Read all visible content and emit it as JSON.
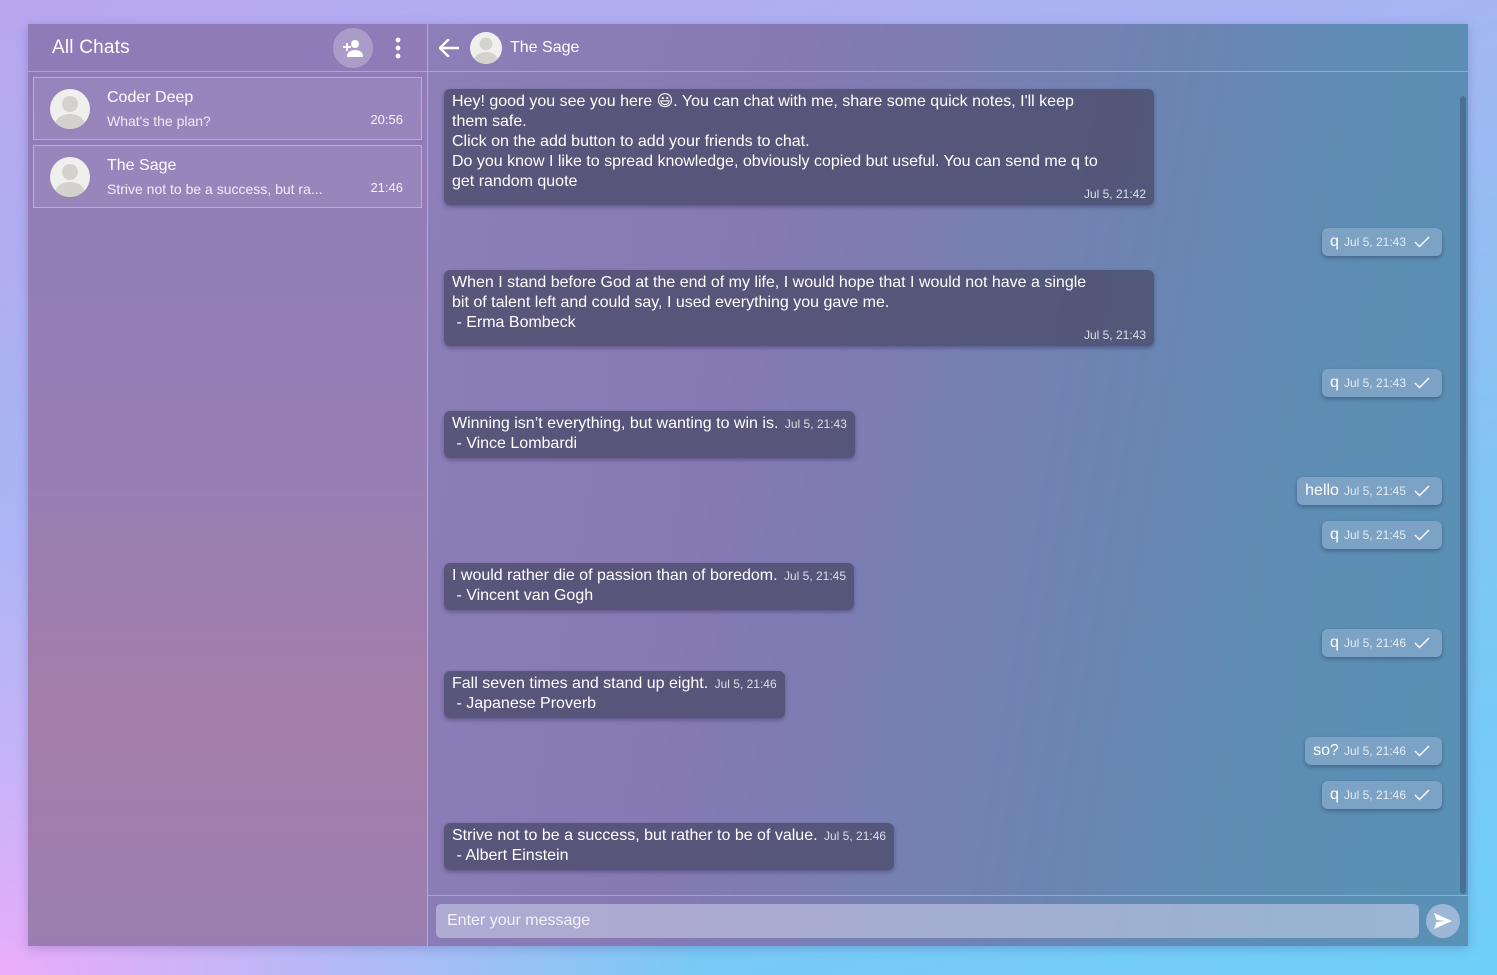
{
  "sidebar": {
    "title": "All Chats",
    "icons": {
      "add_friend": "add-person-icon",
      "menu": "more-vert-icon"
    },
    "chats": [
      {
        "name": "Coder Deep",
        "preview": "What's the plan?",
        "time": "20:56"
      },
      {
        "name": "The Sage",
        "preview": "Strive not to be a success, but ra...",
        "time": "21:46"
      }
    ]
  },
  "header": {
    "name": "The Sage",
    "back_icon": "arrow-left-icon"
  },
  "messages": [
    {
      "dir": "in",
      "lines": [
        "Hey! good you see you here 😃. You can chat with me, share some quick notes, I'll keep",
        "them safe.",
        "Click on the add button to add your friends to chat.",
        "Do you know I like to spread knowledge, obviously copied but useful. You can send me q to",
        "get random quote"
      ],
      "time": "Jul 5, 21:42"
    },
    {
      "dir": "out",
      "text": "q",
      "time": "Jul 5, 21:43"
    },
    {
      "dir": "in",
      "lines": [
        "When I stand before God at the end of my life, I would hope that I would not have a single",
        "bit of talent left and could say, I used everything you gave me.",
        " - Erma Bombeck"
      ],
      "time": "Jul 5, 21:43"
    },
    {
      "dir": "out",
      "text": "q",
      "time": "Jul 5, 21:43"
    },
    {
      "dir": "in",
      "lines": [
        "Winning isn’t everything, but wanting to win is.",
        " - Vince Lombardi"
      ],
      "time": "Jul 5, 21:43"
    },
    {
      "dir": "out",
      "text": "hello",
      "time": "Jul 5, 21:45"
    },
    {
      "dir": "out",
      "text": "q",
      "time": "Jul 5, 21:45"
    },
    {
      "dir": "in",
      "lines": [
        "I would rather die of passion than of boredom.",
        " - Vincent van Gogh"
      ],
      "time": "Jul 5, 21:45"
    },
    {
      "dir": "out",
      "text": "q",
      "time": "Jul 5, 21:46"
    },
    {
      "dir": "in",
      "lines": [
        "Fall seven times and stand up eight.",
        " - Japanese Proverb"
      ],
      "time": "Jul 5, 21:46"
    },
    {
      "dir": "out",
      "text": "so?",
      "time": "Jul 5, 21:46"
    },
    {
      "dir": "out",
      "text": "q",
      "time": "Jul 5, 21:46"
    },
    {
      "dir": "in",
      "lines": [
        "Strive not to be a success, but rather to be of value.",
        " - Albert Einstein"
      ],
      "time": "Jul 5, 21:46"
    }
  ],
  "composer": {
    "placeholder": "Enter your message",
    "send_icon": "send-icon"
  },
  "colors": {
    "incoming_bubble": "#4a4a68",
    "outgoing_bubble": "#a9b9d8"
  }
}
